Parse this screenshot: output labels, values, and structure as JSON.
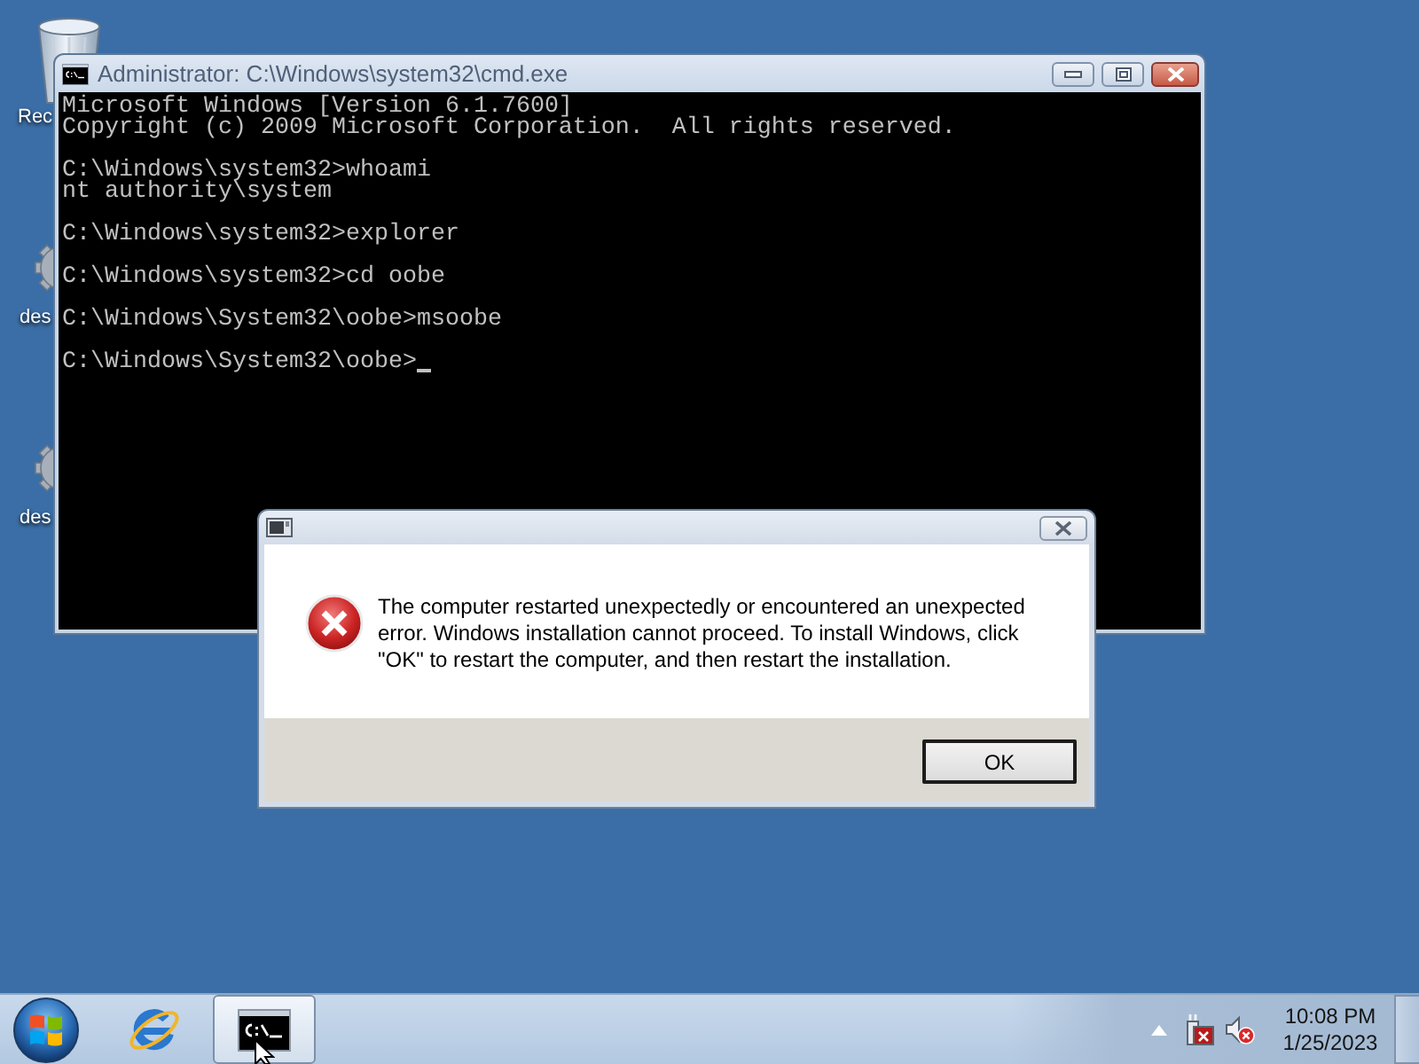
{
  "desktop": {
    "icons": [
      {
        "kind": "recycle-bin",
        "label": "Rec"
      },
      {
        "kind": "settings-file",
        "label": "des"
      },
      {
        "kind": "settings-file",
        "label": "des"
      }
    ]
  },
  "console_window": {
    "title": "Administrator: C:\\Windows\\system32\\cmd.exe",
    "active": false,
    "blocks": [
      [
        "Microsoft Windows [Version 6.1.7600]",
        "Copyright (c) 2009 Microsoft Corporation.  All rights reserved."
      ],
      [
        "C:\\Windows\\system32>whoami",
        "nt authority\\system"
      ],
      [
        "C:\\Windows\\system32>explorer"
      ],
      [
        "C:\\Windows\\system32>cd oobe"
      ],
      [
        "C:\\Windows\\System32\\oobe>msoobe"
      ],
      [
        "C:\\Windows\\System32\\oobe>"
      ]
    ],
    "cursor": true
  },
  "dialog": {
    "kind": "error",
    "message": "The computer restarted unexpectedly or encountered an unexpected error. Windows installation cannot proceed. To install Windows, click \"OK\" to restart the computer, and then restart the installation.",
    "buttons": [
      {
        "label": "OK",
        "default": true
      }
    ]
  },
  "taskbar": {
    "buttons": [
      {
        "kind": "browser",
        "open": false
      },
      {
        "kind": "console",
        "open": true
      }
    ],
    "tray": {
      "icons": [
        {
          "kind": "network",
          "connected": false
        },
        {
          "kind": "volume",
          "muted": true
        }
      ],
      "time": "10:08 PM",
      "date": "1/25/2023"
    }
  }
}
